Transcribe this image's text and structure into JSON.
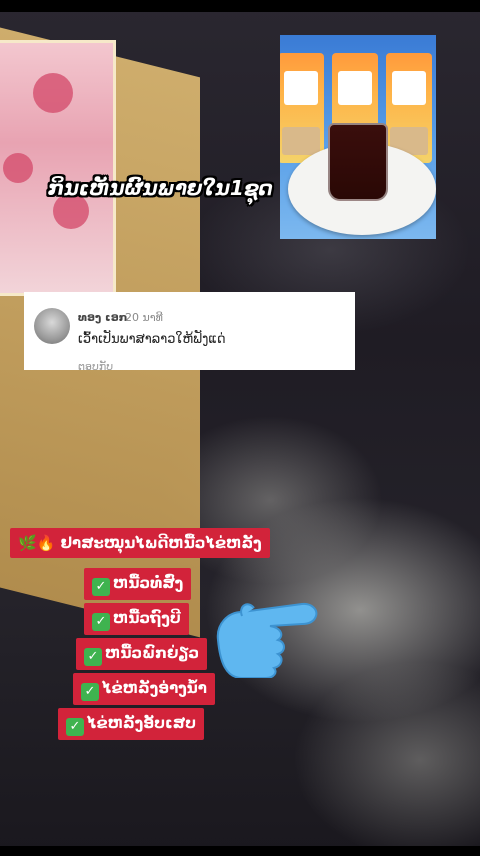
{
  "caption": {
    "text": "ກິນເຫັນຜົນພາຍໃນ1ຊຸດ"
  },
  "comment": {
    "username": "ທອງ ເອກ",
    "time": "· 20 ນາທີ",
    "text": "ເວົ້າເປັນພາສາລາວໃຫ້ຟັງແດ່",
    "reply": "ຕອບກັບ"
  },
  "headline": {
    "icons": "🌿🔥",
    "text": "ຢາສະໝຸນໄພດີຫນື້ວໄຂ່ຫລັງ"
  },
  "items": [
    {
      "check": "✓",
      "text": "ຫນື້ວທໍ່ສົ່ງ"
    },
    {
      "check": "✓",
      "text": "ຫນື້ວຖົງບີ"
    },
    {
      "check": "✓",
      "text": "ຫນື້ວພົກຍ່ຽວ"
    },
    {
      "check": "✓",
      "text": "ໄຂ່ຫລັງອ່າງນ້ຳ"
    },
    {
      "check": "✓",
      "text": "ໄຂ່ຫລັງອັບເສບ"
    }
  ],
  "colors": {
    "tag_bg": "#d2233a",
    "check_bg": "#3fb34f",
    "hand": "#5fb7f0"
  }
}
